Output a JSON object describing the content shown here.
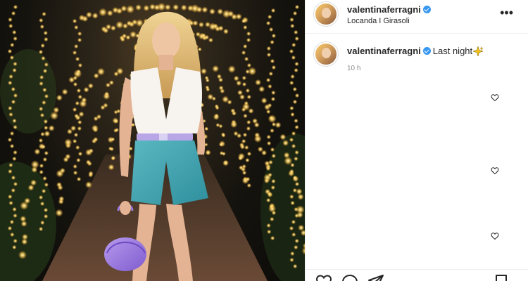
{
  "post": {
    "username": "valentinaferragni",
    "location": "Locanda I Girasoli",
    "more_label": "•••",
    "caption_text": "Last night",
    "caption_emoji": "sparkles-icon",
    "time": "10 h"
  },
  "icons": [
    "verified-badge-icon",
    "more-options-icon",
    "like-icon",
    "comment-icon",
    "share-icon",
    "save-icon"
  ],
  "colors": {
    "verified": "#3897f0",
    "meta": "#8e8e8e",
    "text": "#262626"
  }
}
